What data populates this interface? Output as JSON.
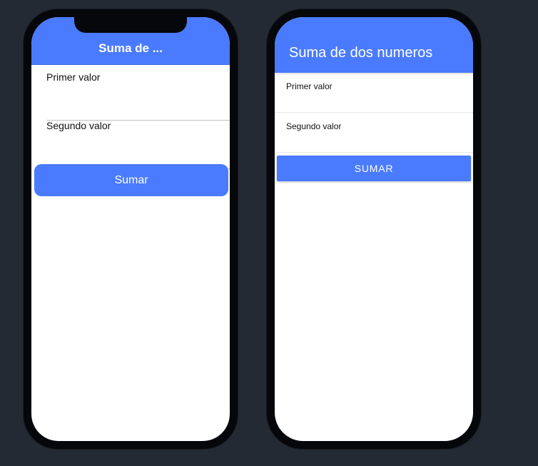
{
  "colors": {
    "background": "#242a33",
    "device": "#05070b",
    "screen": "#ffffff",
    "accent": "#4a7bff",
    "divider": "#bfc3c8"
  },
  "ios_preview": {
    "header": {
      "title": "Suma de ..."
    },
    "form": {
      "first_label": "Primer valor",
      "second_label": "Segundo valor",
      "button_label": "Sumar"
    }
  },
  "android_preview": {
    "status_bar": {
      "left": "",
      "right": ""
    },
    "header": {
      "title": "Suma de dos numeros"
    },
    "form": {
      "first_label": "Primer valor",
      "second_label": "Segundo valor",
      "button_label": "SUMAR"
    }
  }
}
